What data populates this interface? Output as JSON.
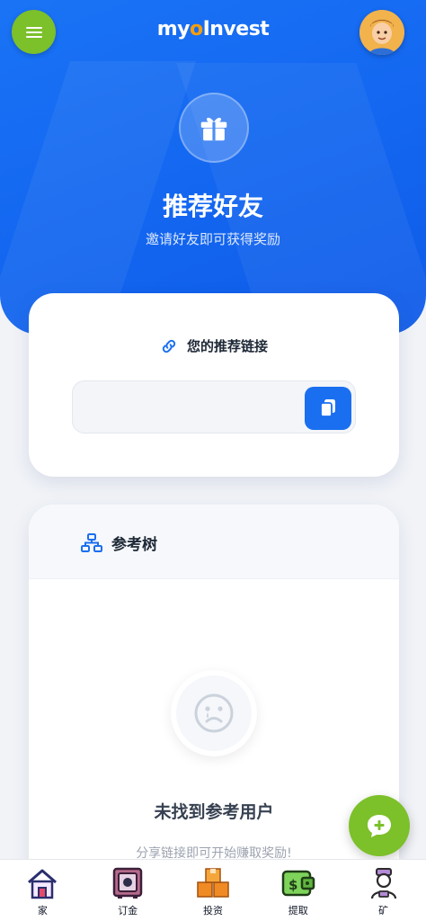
{
  "header": {
    "logo_my": "my",
    "logo_o": "o",
    "logo_rest": "Invest"
  },
  "hero": {
    "title": "推荐好友",
    "subtitle": "邀请好友即可获得奖励"
  },
  "referral": {
    "title": "您的推荐链接",
    "link_value": ""
  },
  "tree": {
    "title": "参考树",
    "empty_title": "未找到参考用户",
    "empty_subtitle": "分享链接即可开始赚取奖励!"
  },
  "nav": {
    "items": [
      {
        "label": "家"
      },
      {
        "label": "订金"
      },
      {
        "label": "投资"
      },
      {
        "label": "提取"
      },
      {
        "label": "矿"
      }
    ]
  },
  "colors": {
    "brand_blue": "#1a6ff0",
    "accent_green": "#7cc02a",
    "logo_orange": "#f59e0b"
  }
}
